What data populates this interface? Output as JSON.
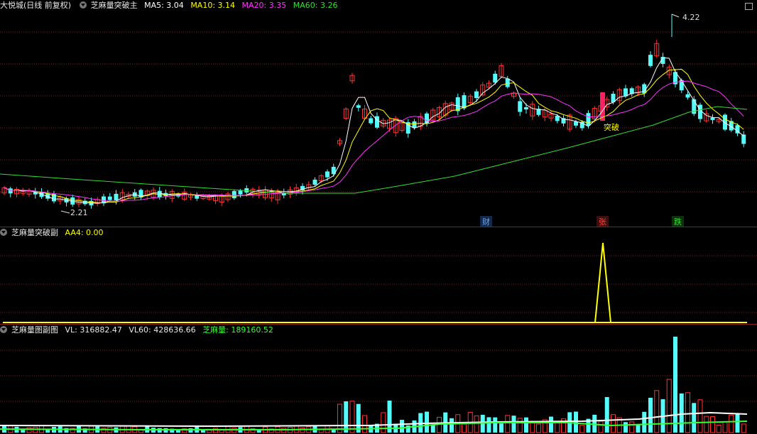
{
  "main": {
    "title": "大悦城(日线 前复权)",
    "indicator": "芝麻量突破主",
    "ma": [
      {
        "label": "MA5: 3.04",
        "color": "#ffffff"
      },
      {
        "label": "MA10: 3.14",
        "color": "#ffff00"
      },
      {
        "label": "MA20: 3.35",
        "color": "#ff33ff"
      },
      {
        "label": "MA60: 3.26",
        "color": "#33dd33"
      }
    ],
    "high_label": "4.22",
    "low_label": "2.21",
    "signal_label": "突破",
    "markers": [
      {
        "text": "财",
        "color": "#5aaaff"
      },
      {
        "text": "张",
        "color": "#ff4444"
      },
      {
        "text": "跌",
        "color": "#33dd33"
      }
    ]
  },
  "sub1": {
    "indicator": "芝麻量突破副",
    "aa4": "AA4: 0.00"
  },
  "sub2": {
    "indicator": "芝麻量图副图",
    "vl": "VL: 316882.47",
    "vl60": "VL60: 428636.66",
    "zmliang": "芝麻量: 189160.52"
  },
  "colors": {
    "up": "#ff3232",
    "down": "#54fcfc",
    "grid": "#8a1c1c",
    "ma5": "#ffffff",
    "ma10": "#ffff00",
    "ma20": "#ff33ff",
    "ma60": "#33dd33",
    "aa4": "#ffff00",
    "vl": "#ffffff",
    "zml": "#33ff33"
  }
}
